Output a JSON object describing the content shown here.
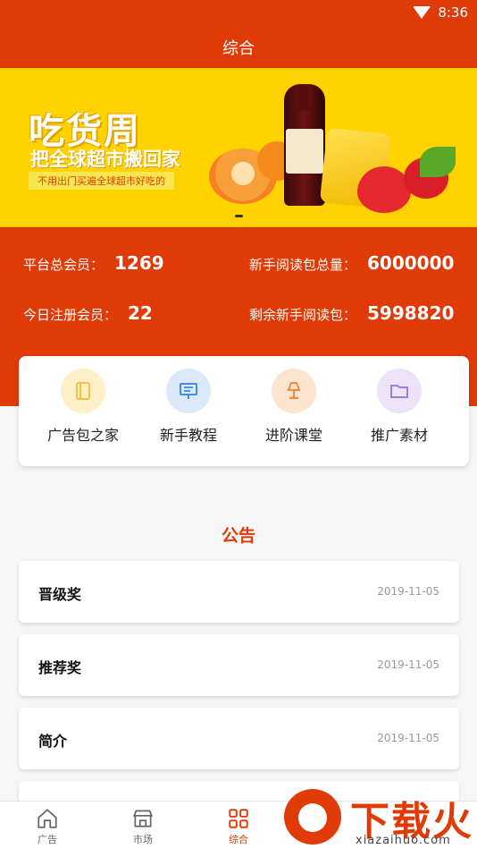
{
  "status_bar": {
    "time": "8:36",
    "icons": [
      "wifi-icon",
      "battery-icon"
    ]
  },
  "header": {
    "title": "综合"
  },
  "banner": {
    "title": "吃货周",
    "subtitle": "把全球超市搬回家",
    "tagline": "不用出门买遍全球超市好吃的"
  },
  "stats": {
    "total_members_label": "平台总会员：",
    "total_members_value": "1269",
    "new_reading_total_label": "新手阅读包总量：",
    "new_reading_total_value": "6000000",
    "today_registered_label": "今日注册会员：",
    "today_registered_value": "22",
    "remaining_reading_label": "剩余新手阅读包：",
    "remaining_reading_value": "5998820"
  },
  "quick_menu": [
    {
      "label": "广告包之家",
      "icon": "book-icon",
      "color": "#f5c242"
    },
    {
      "label": "新手教程",
      "icon": "presentation-icon",
      "color": "#3f8de0"
    },
    {
      "label": "进阶课堂",
      "icon": "lamp-icon",
      "color": "#f08a3a"
    },
    {
      "label": "推广素材",
      "icon": "folder-icon",
      "color": "#a27ae6"
    }
  ],
  "notices": {
    "section_title": "公告",
    "items": [
      {
        "title": "晋级奖",
        "date": "2019-11-05"
      },
      {
        "title": "推荐奖",
        "date": "2019-11-05"
      },
      {
        "title": "简介",
        "date": "2019-11-05"
      }
    ]
  },
  "tabbar": [
    {
      "label": "广告",
      "icon": "home-icon",
      "active": false
    },
    {
      "label": "市场",
      "icon": "store-icon",
      "active": false
    },
    {
      "label": "综合",
      "icon": "grid-icon",
      "active": true
    }
  ],
  "watermark": {
    "brand": "下载火",
    "url": "xiazaihuo.com"
  },
  "colors": {
    "primary": "#e03a06",
    "banner_bg": "#ffd200"
  }
}
